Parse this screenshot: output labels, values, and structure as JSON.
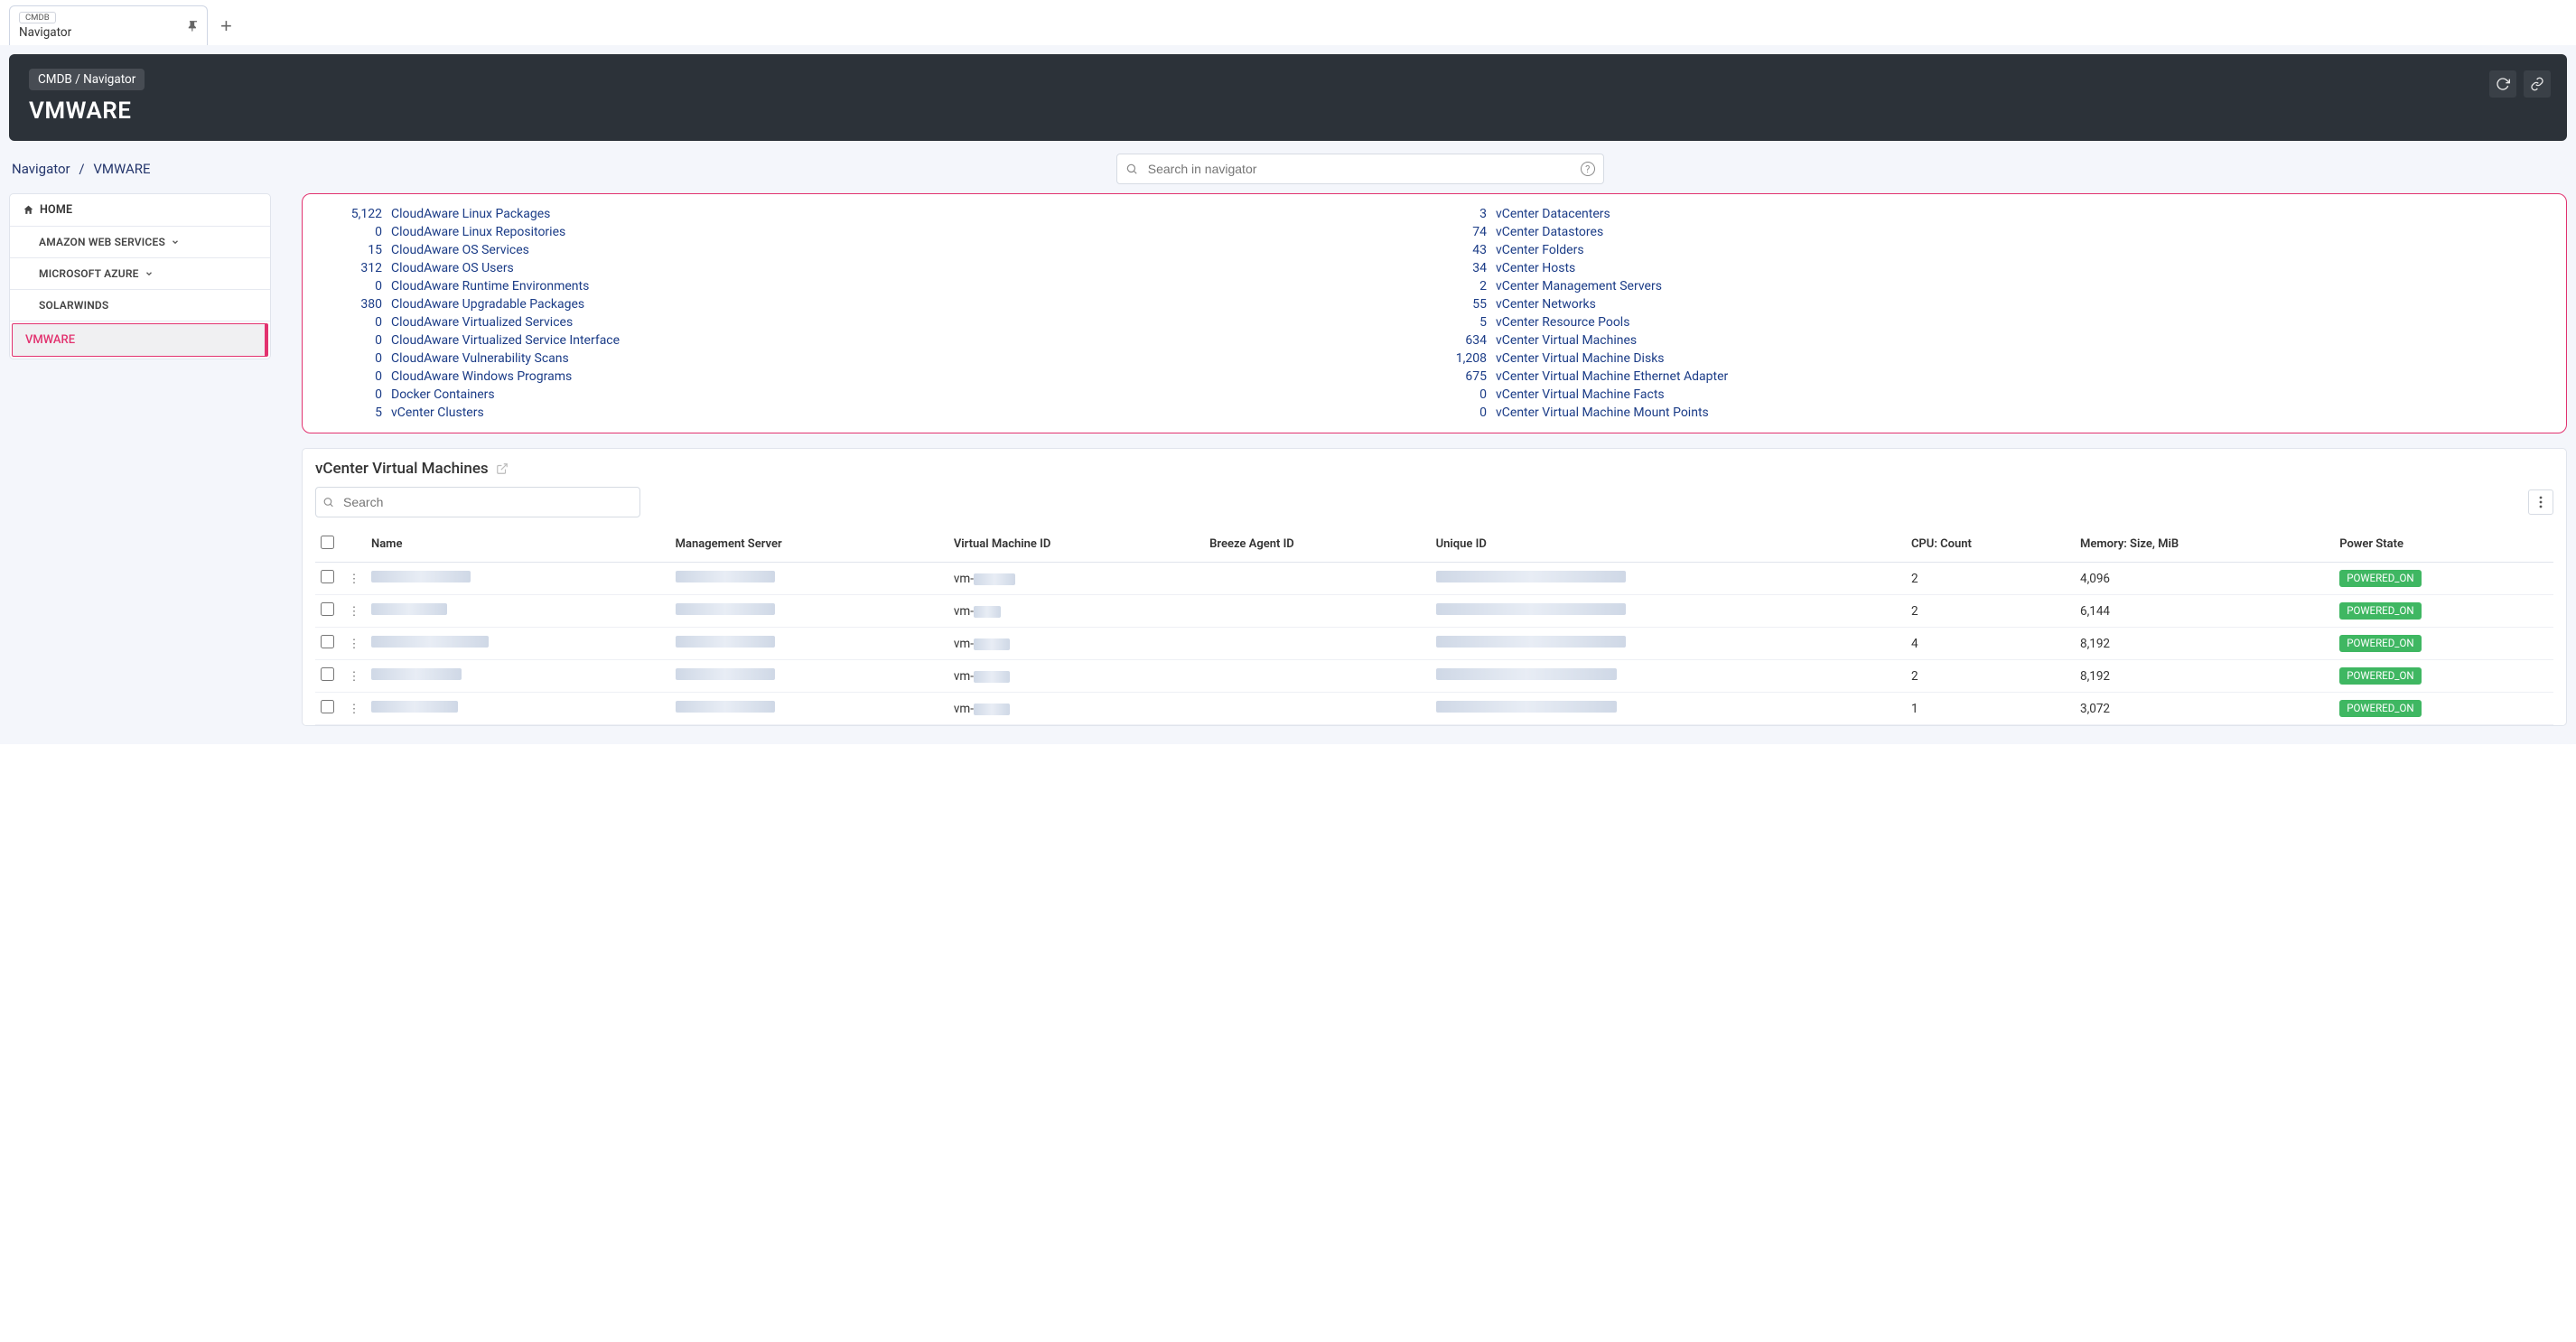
{
  "tab": {
    "chip": "CMDB",
    "title": "Navigator"
  },
  "header": {
    "breadcrumb": "CMDB / Navigator",
    "title": "VMWARE"
  },
  "subBreadcrumb": {
    "a": "Navigator",
    "sep": "/",
    "b": "VMWARE"
  },
  "search": {
    "placeholder": "Search in navigator"
  },
  "sidebar": {
    "items": [
      {
        "label": "HOME",
        "home": true
      },
      {
        "label": "AMAZON WEB SERVICES",
        "expandable": true
      },
      {
        "label": "MICROSOFT AZURE",
        "expandable": true
      },
      {
        "label": "SOLARWINDS"
      },
      {
        "label": "VMWARE",
        "selected": true
      }
    ]
  },
  "stats": {
    "left": [
      {
        "count": "5,122",
        "label": "CloudAware Linux Packages"
      },
      {
        "count": "0",
        "label": "CloudAware Linux Repositories"
      },
      {
        "count": "15",
        "label": "CloudAware OS Services"
      },
      {
        "count": "312",
        "label": "CloudAware OS Users"
      },
      {
        "count": "0",
        "label": "CloudAware Runtime Environments"
      },
      {
        "count": "380",
        "label": "CloudAware Upgradable Packages"
      },
      {
        "count": "0",
        "label": "CloudAware Virtualized Services"
      },
      {
        "count": "0",
        "label": "CloudAware Virtualized Service Interface"
      },
      {
        "count": "0",
        "label": "CloudAware Vulnerability Scans"
      },
      {
        "count": "0",
        "label": "CloudAware Windows Programs"
      },
      {
        "count": "0",
        "label": "Docker Containers"
      },
      {
        "count": "5",
        "label": "vCenter Clusters"
      }
    ],
    "right": [
      {
        "count": "3",
        "label": "vCenter Datacenters"
      },
      {
        "count": "74",
        "label": "vCenter Datastores"
      },
      {
        "count": "43",
        "label": "vCenter Folders"
      },
      {
        "count": "34",
        "label": "vCenter Hosts"
      },
      {
        "count": "2",
        "label": "vCenter Management Servers"
      },
      {
        "count": "55",
        "label": "vCenter Networks"
      },
      {
        "count": "5",
        "label": "vCenter Resource Pools"
      },
      {
        "count": "634",
        "label": "vCenter Virtual Machines"
      },
      {
        "count": "1,208",
        "label": "vCenter Virtual Machine Disks"
      },
      {
        "count": "675",
        "label": "vCenter Virtual Machine Ethernet Adapter"
      },
      {
        "count": "0",
        "label": "vCenter Virtual Machine Facts"
      },
      {
        "count": "0",
        "label": "vCenter Virtual Machine Mount Points"
      }
    ]
  },
  "table": {
    "title": "vCenter Virtual Machines",
    "searchPlaceholder": "Search",
    "columns": [
      "Name",
      "Management Server",
      "Virtual Machine ID",
      "Breeze Agent ID",
      "Unique ID",
      "CPU: Count",
      "Memory: Size, MiB",
      "Power State"
    ],
    "rows": [
      {
        "vmid_prefix": "vm-",
        "cpu": "2",
        "mem": "4,096",
        "state": "POWERED_ON",
        "nameW": 110,
        "msW": 110,
        "vmW": 46,
        "uidW": 210
      },
      {
        "vmid_prefix": "vm-",
        "cpu": "2",
        "mem": "6,144",
        "state": "POWERED_ON",
        "nameW": 84,
        "msW": 110,
        "vmW": 30,
        "uidW": 210
      },
      {
        "vmid_prefix": "vm-",
        "cpu": "4",
        "mem": "8,192",
        "state": "POWERED_ON",
        "nameW": 130,
        "msW": 110,
        "vmW": 40,
        "uidW": 210
      },
      {
        "vmid_prefix": "vm-",
        "cpu": "2",
        "mem": "8,192",
        "state": "POWERED_ON",
        "nameW": 100,
        "msW": 110,
        "vmW": 40,
        "uidW": 200
      },
      {
        "vmid_prefix": "vm-",
        "cpu": "1",
        "mem": "3,072",
        "state": "POWERED_ON",
        "nameW": 96,
        "msW": 110,
        "vmW": 40,
        "uidW": 200
      }
    ]
  }
}
